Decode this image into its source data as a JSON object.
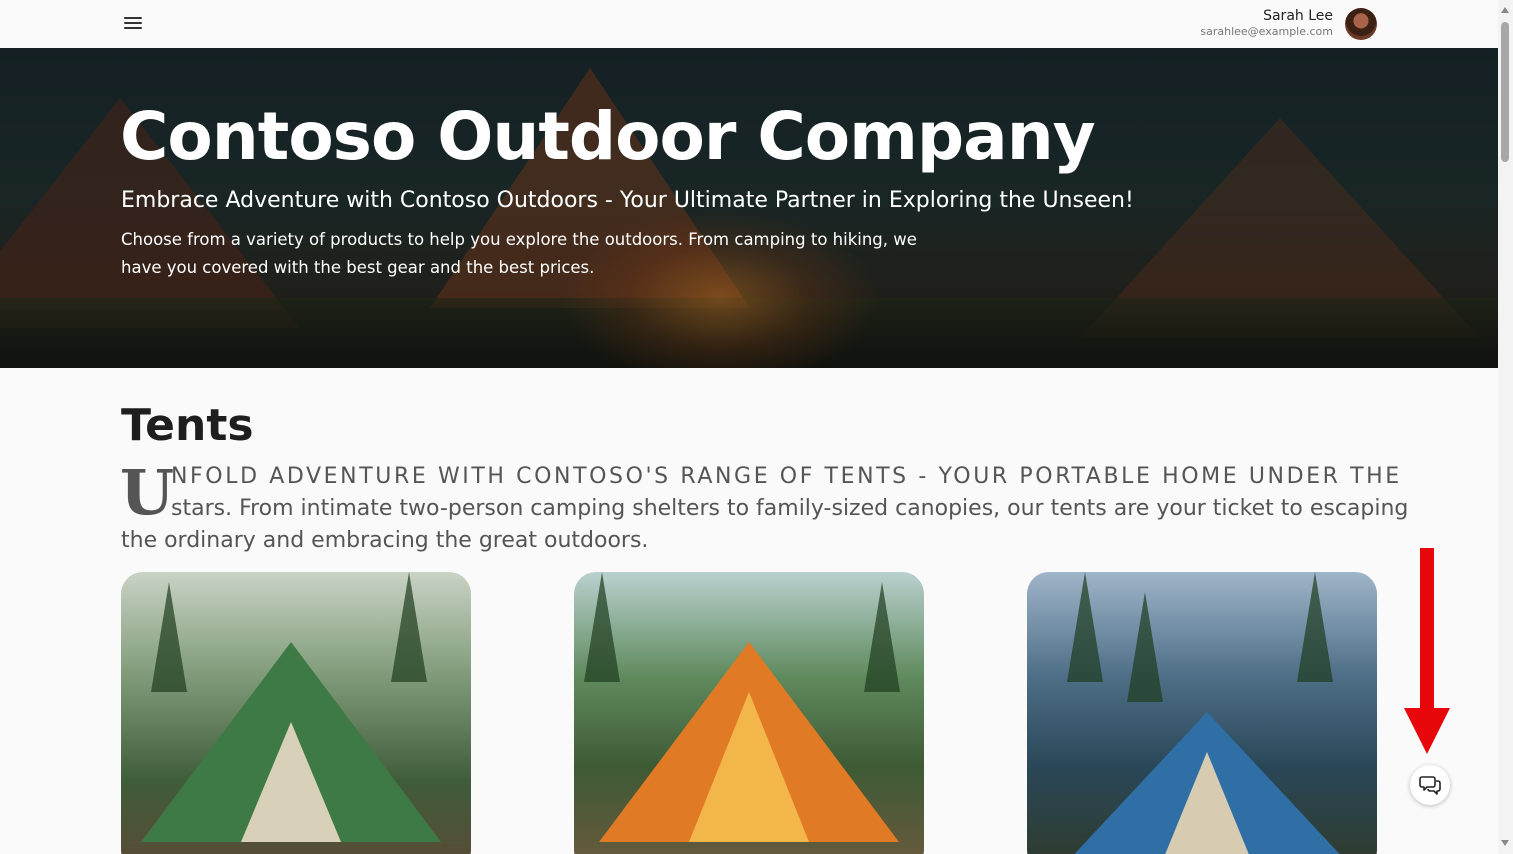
{
  "user": {
    "name": "Sarah Lee",
    "email": "sarahlee@example.com"
  },
  "hero": {
    "title": "Contoso Outdoor Company",
    "subtitle": "Embrace Adventure with Contoso Outdoors - Your Ultimate Partner in Exploring the Unseen!",
    "description": "Choose from a variety of products to help you explore the outdoors. From camping to hiking, we have you covered with the best gear and the best prices."
  },
  "section": {
    "title": "Tents",
    "intro_dropcap": "U",
    "intro_line1": "NFOLD ADVENTURE WITH CONTOSO'S RANGE OF TENTS - YOUR PORTABLE HOME UNDER THE",
    "intro_line2": "stars. From intimate two-person camping shelters to family-sized canopies, our tents are your ticket to escaping",
    "intro_line3": "the ordinary and embracing the great outdoors."
  },
  "icons": {
    "menu": "hamburger-menu-icon",
    "chat": "chat-bubbles-icon",
    "annotation": "red-arrow-down"
  },
  "colors": {
    "annotation_arrow": "#e8070b",
    "page_background": "#fafafa"
  }
}
